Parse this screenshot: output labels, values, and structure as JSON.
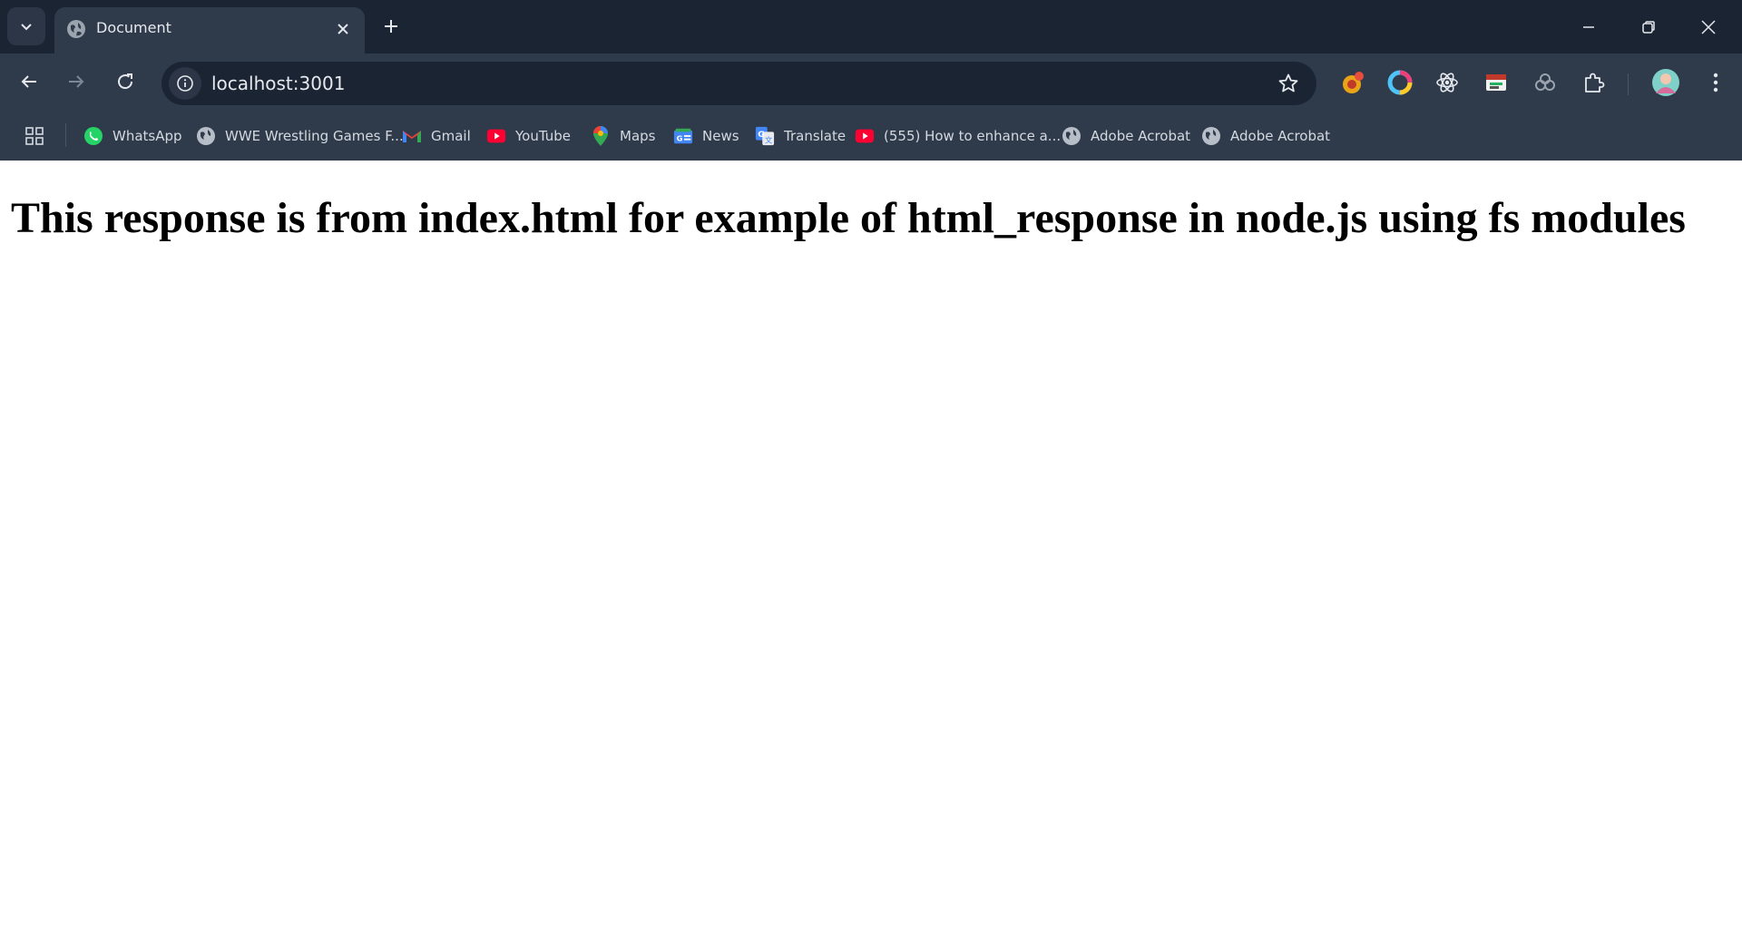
{
  "browser": {
    "tab": {
      "title": "Document"
    },
    "address_bar": {
      "url": "localhost:3001"
    },
    "bookmarks": [
      {
        "label": "WhatsApp",
        "icon": "whatsapp-icon"
      },
      {
        "label": "WWE Wrestling Games F...",
        "icon": "globe-icon"
      },
      {
        "label": "Gmail",
        "icon": "gmail-icon"
      },
      {
        "label": "YouTube",
        "icon": "youtube-icon"
      },
      {
        "label": "Maps",
        "icon": "maps-icon"
      },
      {
        "label": "News",
        "icon": "news-icon"
      },
      {
        "label": "Translate",
        "icon": "translate-icon"
      },
      {
        "label": "(555) How to enhance a...",
        "icon": "youtube-icon"
      },
      {
        "label": "Adobe Acrobat",
        "icon": "globe-icon"
      },
      {
        "label": "Adobe Acrobat",
        "icon": "globe-icon"
      }
    ],
    "colors": {
      "frame": "#1b2433",
      "toolbar": "#2f3a4b",
      "text": "#e6e9ee"
    }
  },
  "page": {
    "heading": "This response is from index.html for example of html_response in node.js using fs modules"
  }
}
